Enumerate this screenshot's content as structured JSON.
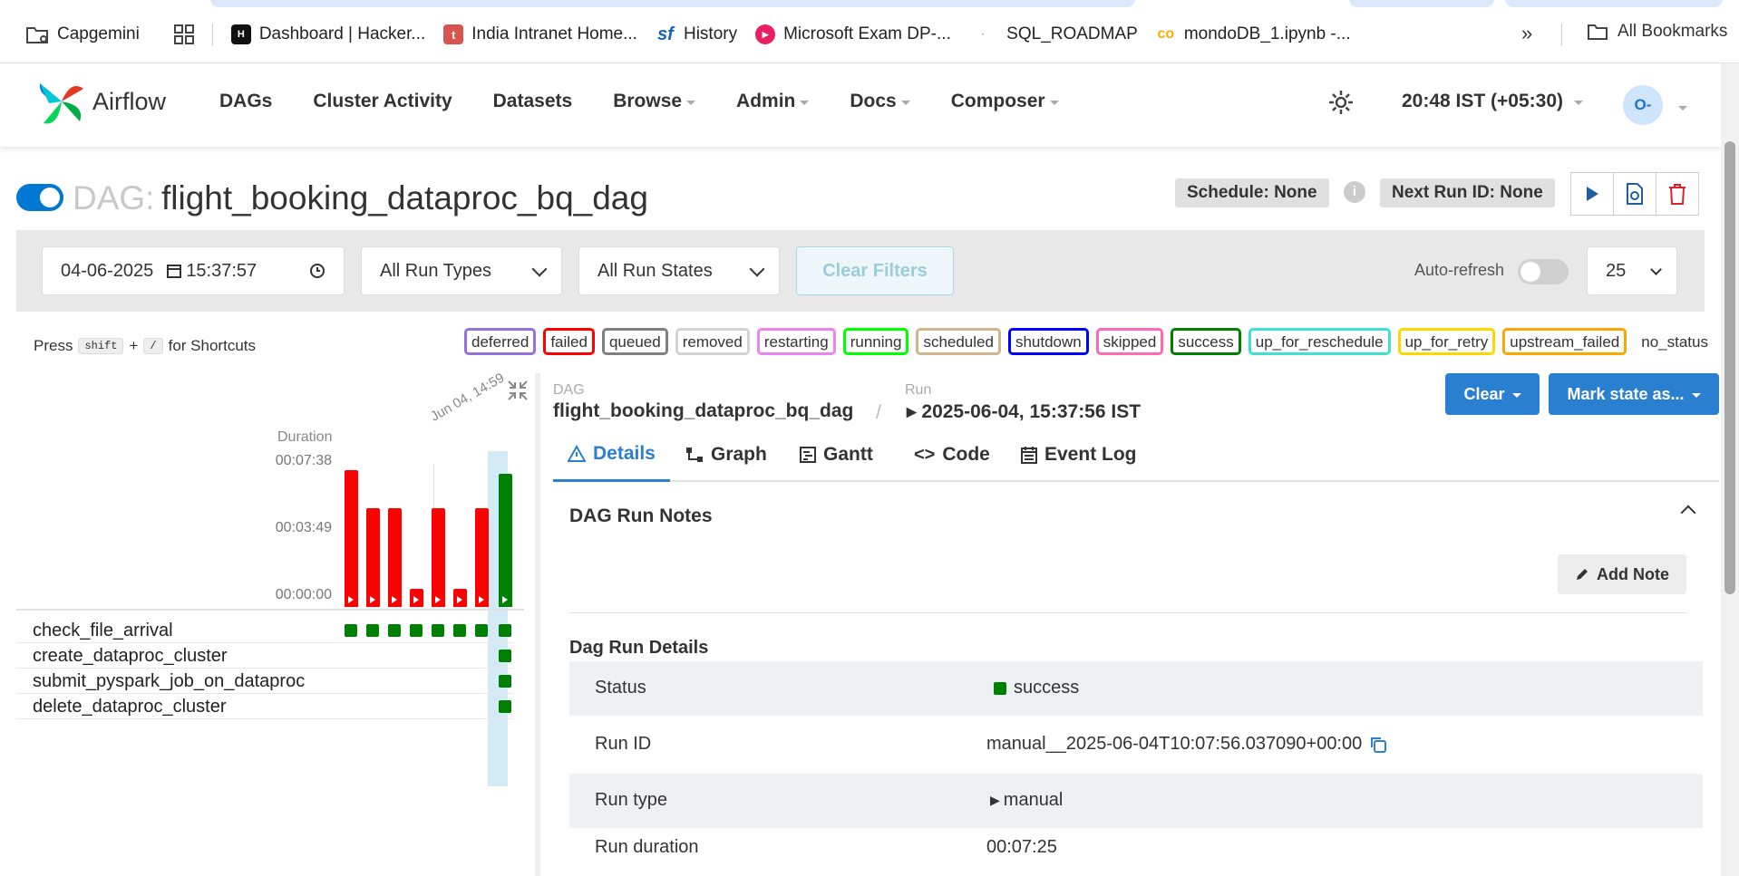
{
  "bookmarks": {
    "items": [
      {
        "label": "Capgemini",
        "icon": "folder-icon"
      },
      {
        "label": "Dashboard | Hacker...",
        "icon": "hackerrank-icon"
      },
      {
        "label": "India Intranet Home...",
        "icon": "intranet-icon"
      },
      {
        "label": "History",
        "icon": "sf-icon"
      },
      {
        "label": "Microsoft Exam DP-...",
        "icon": "play-icon"
      },
      {
        "label": "SQL_ROADMAP",
        "icon": ""
      },
      {
        "label": "mondoDB_1.ipynb -...",
        "icon": "colab-icon"
      }
    ],
    "all_bookmarks": "All Bookmarks",
    "more": "»"
  },
  "nav": {
    "brand": "Airflow",
    "menu": [
      "DAGs",
      "Cluster Activity",
      "Datasets",
      "Browse",
      "Admin",
      "Docs",
      "Composer"
    ],
    "time": "20:48 IST (+05:30)",
    "avatar": "O-"
  },
  "dag": {
    "prefix": "DAG:",
    "name": "flight_booking_dataproc_bq_dag",
    "schedule": "Schedule: None",
    "next_run": "Next Run ID: None"
  },
  "filters": {
    "date": "04-06-2025",
    "time": "15:37:57",
    "run_types": "All Run Types",
    "run_states": "All Run States",
    "clear": "Clear Filters",
    "auto_refresh": "Auto-refresh",
    "page_size": "25"
  },
  "shortcuts": {
    "press": "Press",
    "key1": "shift",
    "plus": "+",
    "key2": "/",
    "for": "for Shortcuts"
  },
  "states": [
    {
      "label": "deferred",
      "color": "#9370db"
    },
    {
      "label": "failed",
      "color": "#ff0000"
    },
    {
      "label": "queued",
      "color": "#808080"
    },
    {
      "label": "removed",
      "color": "#d3d3d3"
    },
    {
      "label": "restarting",
      "color": "#ee82ee"
    },
    {
      "label": "running",
      "color": "#00ff00"
    },
    {
      "label": "scheduled",
      "color": "#d2b48c"
    },
    {
      "label": "shutdown",
      "color": "#0000ff"
    },
    {
      "label": "skipped",
      "color": "#ff69b4"
    },
    {
      "label": "success",
      "color": "#008000"
    },
    {
      "label": "up_for_reschedule",
      "color": "#40e0d0"
    },
    {
      "label": "up_for_retry",
      "color": "#ffd700"
    },
    {
      "label": "upstream_failed",
      "color": "#ffa500"
    },
    {
      "label": "no_status",
      "color": "#ffffff"
    }
  ],
  "grid": {
    "duration_label": "Duration",
    "ticks": [
      "00:07:38",
      "00:03:49",
      "00:00:00"
    ],
    "date_label": "Jun 04, 14:59",
    "tasks": [
      "check_file_arrival",
      "create_dataproc_cluster",
      "submit_pyspark_job_on_dataproc",
      "delete_dataproc_cluster"
    ]
  },
  "chart_data": {
    "type": "bar",
    "ylabel": "Duration",
    "ylim": [
      "00:00:00",
      "00:07:38"
    ],
    "values_minutes": [
      7.6,
      5.5,
      5.5,
      1.0,
      5.5,
      1.0,
      5.5,
      7.4
    ],
    "states": [
      "failed",
      "failed",
      "failed",
      "failed",
      "failed",
      "failed",
      "failed",
      "success"
    ]
  },
  "details": {
    "dag_crumb": "DAG",
    "dag_name": "flight_booking_dataproc_bq_dag",
    "run_crumb": "Run",
    "run_value": "2025-06-04, 15:37:56 IST",
    "clear_btn": "Clear",
    "mark_btn": "Mark state as...",
    "tabs": [
      "Details",
      "Graph",
      "Gantt",
      "Code",
      "Event Log"
    ],
    "notes_title": "DAG Run Notes",
    "add_note": "Add Note",
    "run_details_title": "Dag Run Details",
    "rows": [
      {
        "key": "Status",
        "value": "success"
      },
      {
        "key": "Run ID",
        "value": "manual__2025-06-04T10:07:56.037090+00:00"
      },
      {
        "key": "Run type",
        "value": "manual"
      },
      {
        "key": "Run duration",
        "value": "00:07:25"
      }
    ]
  }
}
